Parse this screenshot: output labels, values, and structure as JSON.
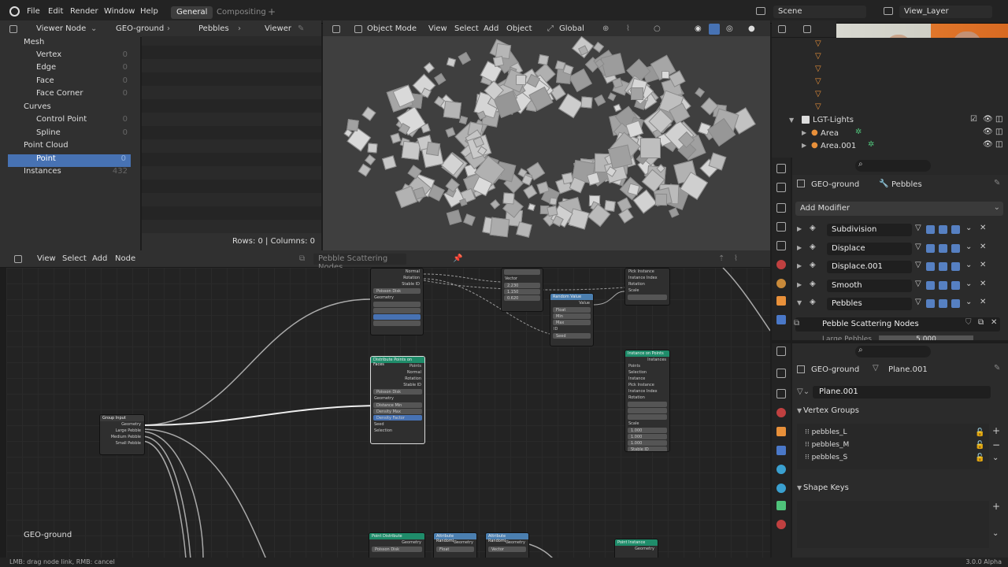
{
  "menu": {
    "items": [
      "File",
      "Edit",
      "Render",
      "Window",
      "Help"
    ],
    "tabs": [
      "General",
      "Compositing"
    ],
    "scene": "Scene",
    "view_layer": "View_Layer"
  },
  "spreadsheet_header": {
    "viewer": "Viewer Node",
    "object": "GEO-ground",
    "modifier": "Pebbles",
    "node": "Viewer"
  },
  "spreadsheet": {
    "items": [
      {
        "label": "Mesh",
        "count": ""
      },
      {
        "label": "Vertex",
        "count": "0"
      },
      {
        "label": "Edge",
        "count": "0"
      },
      {
        "label": "Face",
        "count": "0"
      },
      {
        "label": "Face Corner",
        "count": "0"
      },
      {
        "label": "Curves",
        "count": ""
      },
      {
        "label": "Control Point",
        "count": "0"
      },
      {
        "label": "Spline",
        "count": "0"
      },
      {
        "label": "Point Cloud",
        "count": ""
      },
      {
        "label": "Point",
        "count": "0"
      },
      {
        "label": "Instances",
        "count": "432"
      }
    ],
    "footer": "Rows: 0   |   Columns: 0"
  },
  "viewport_header": {
    "mode": "Object Mode",
    "menus": [
      "View",
      "Select",
      "Add",
      "Object"
    ],
    "orientation": "Global"
  },
  "node_editor": {
    "menus": [
      "View",
      "Select",
      "Add",
      "Node"
    ],
    "tree_name": "Pebble Scattering Nodes",
    "object_label": "GEO-ground",
    "nodes": {
      "group_input": "Group Input",
      "group_input_outputs": [
        "Geometry",
        "Large Pebble",
        "Medium Pebble",
        "Small Pebble"
      ],
      "distribute": "Distribute Points on Faces",
      "distribute_outputs": [
        "Points",
        "Normal",
        "Rotation",
        "Stable ID"
      ],
      "distribute_mode": "Poisson Disk",
      "distribute_fields": [
        "Distance Min",
        "Density Max",
        "Density Factor",
        "Seed",
        "Selection"
      ],
      "distribute_values": [
        "0.000",
        "10.000",
        "1.000",
        "0"
      ],
      "random_value": "Random Value",
      "random_type": "Float",
      "random_fields": [
        "Min",
        "Max",
        "ID",
        "Seed"
      ],
      "random_values": [
        "0.100",
        "1.750",
        "",
        "0"
      ],
      "instance": "Instance on Points",
      "instance_inputs": [
        "Points",
        "Selection",
        "Instance",
        "Pick Instance",
        "Instance Index",
        "Rotation",
        "Scale",
        "Stable ID"
      ],
      "scale_values": [
        "1.000",
        "1.000",
        "1.000"
      ],
      "vector_values": [
        "2.230",
        "1.150",
        "0.620"
      ],
      "bottom": [
        "Point Distribute",
        "Attribute Randomi...",
        "Attribute Randomi...",
        "Point Instance"
      ]
    }
  },
  "outliner": {
    "items": [
      "LGT-Lights",
      "Area",
      "Area.001"
    ]
  },
  "modifiers": {
    "object": "GEO-ground",
    "modifier": "Pebbles",
    "add_label": "Add Modifier",
    "list": [
      "Subdivision",
      "Displace",
      "Displace.001",
      "Smooth",
      "Pebbles"
    ],
    "node_group": "Pebble Scattering Nodes",
    "cut_label": "Large Pebbles",
    "cut_value": "5.000"
  },
  "data_props": {
    "object": "GEO-ground",
    "mesh": "Plane.001",
    "mesh_field": "Plane.001",
    "vertex_groups_title": "Vertex Groups",
    "vertex_groups": [
      "pebbles_L",
      "pebbles_M",
      "pebbles_S"
    ],
    "shape_keys_title": "Shape Keys"
  },
  "status": {
    "left": "LMB: drag node link, RMB: cancel",
    "right": "3.0.0 Alpha"
  },
  "colors": {
    "accent": "#4772b3",
    "node_green": "#1f8c6a",
    "node_blue": "#4b7fb0"
  }
}
